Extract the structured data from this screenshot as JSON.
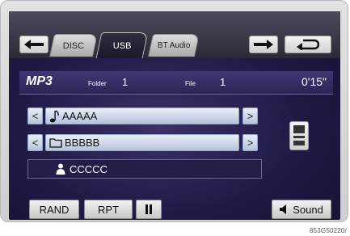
{
  "tabs": [
    {
      "label": "DISC",
      "active": false
    },
    {
      "label": "USB",
      "active": true
    },
    {
      "label": "BT Audio",
      "active": false
    }
  ],
  "nav": {
    "back_icon": "arrow-left-icon",
    "forward_icon": "arrow-right-icon",
    "return_icon": "return-icon"
  },
  "info": {
    "source": "MP3",
    "folder_label": "Folder",
    "folder_value": "1",
    "file_label": "File",
    "file_value": "1",
    "time": "0'15\""
  },
  "rows": {
    "track": {
      "icon": "music-note-icon",
      "text": "AAAAA"
    },
    "folder": {
      "icon": "folder-icon",
      "text": "BBBBB"
    },
    "artist": {
      "icon": "person-icon",
      "text": "CCCCC"
    },
    "prev_glyph": "<",
    "next_glyph": ">"
  },
  "device_icon": "usb-device-icon",
  "bottom": {
    "rand": "RAND",
    "rpt": "RPT",
    "pause_icon": "pause-icon",
    "sound": "Sound",
    "sound_icon": "speaker-icon"
  },
  "image_code": "853G50220/"
}
